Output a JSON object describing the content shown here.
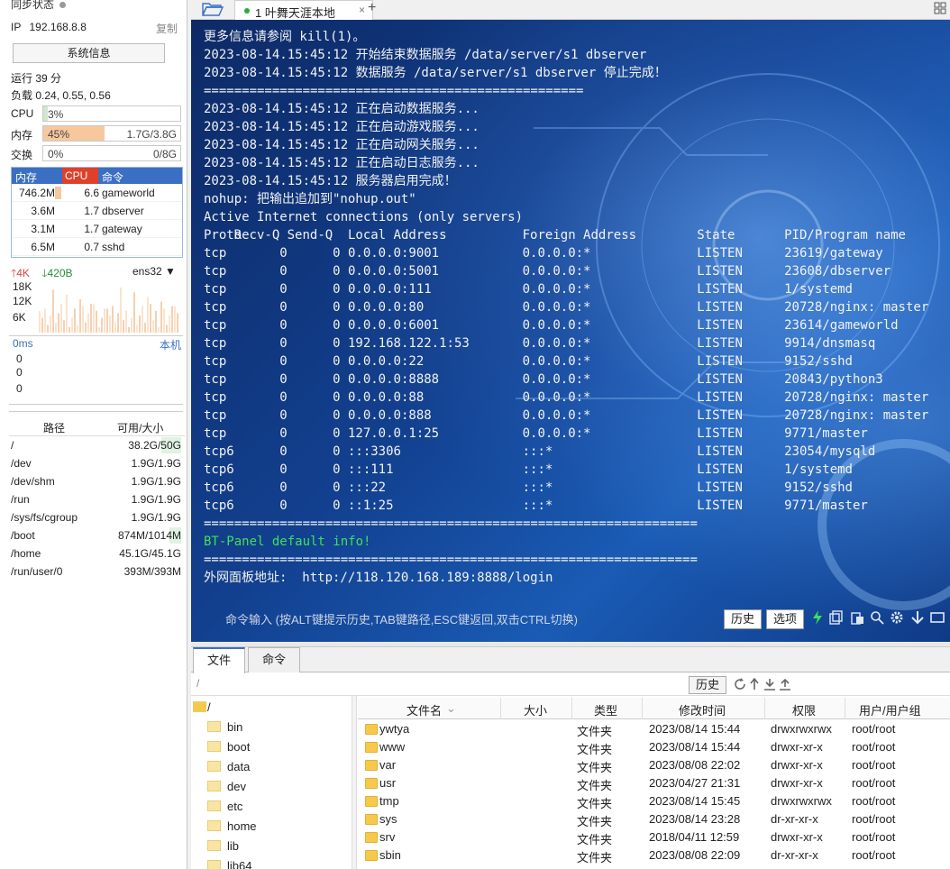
{
  "sidebar": {
    "sync_label": "同步状态",
    "ip_label": "IP",
    "ip": "192.168.8.8",
    "copy_label": "复制",
    "sysinfo_button": "系统信息",
    "uptime": "运行 39 分",
    "load": "负载 0.24, 0.55, 0.56",
    "cpu": {
      "label": "CPU",
      "pct": "3%",
      "fraction": 0.03
    },
    "mem": {
      "label": "内存",
      "pct": "45%",
      "amount": "1.7G/3.8G",
      "fraction": 0.45
    },
    "swap": {
      "label": "交换",
      "pct": "0%",
      "amount": "0/8G",
      "fraction": 0
    },
    "proc_headers": [
      "内存",
      "CPU",
      "命令"
    ],
    "processes": [
      {
        "mem": "746.2M",
        "cpu": "6.6",
        "cmd": "gameworld"
      },
      {
        "mem": "3.6M",
        "cpu": "1.7",
        "cmd": "dbserver"
      },
      {
        "mem": "3.1M",
        "cpu": "1.7",
        "cmd": "gateway"
      },
      {
        "mem": "6.5M",
        "cpu": "0.7",
        "cmd": "sshd"
      }
    ],
    "net_up": "4K",
    "net_down": "420B",
    "net_iface": "ens32",
    "graph_labels": [
      "18K",
      "12K",
      "6K"
    ],
    "latency_ms": "0ms",
    "latency_local": "本机",
    "latency_values": [
      "0",
      "0",
      "0"
    ],
    "disk_headers": [
      "路径",
      "可用/大小"
    ],
    "disks": [
      {
        "path": "/",
        "size": "38.2G/50G",
        "used_fraction": 0.24
      },
      {
        "path": "/dev",
        "size": "1.9G/1.9G",
        "used_fraction": 0
      },
      {
        "path": "/dev/shm",
        "size": "1.9G/1.9G",
        "used_fraction": 0
      },
      {
        "path": "/run",
        "size": "1.9G/1.9G",
        "used_fraction": 0
      },
      {
        "path": "/sys/fs/cgroup",
        "size": "1.9G/1.9G",
        "used_fraction": 0
      },
      {
        "path": "/boot",
        "size": "874M/1014M",
        "used_fraction": 0.14
      },
      {
        "path": "/home",
        "size": "45.1G/45.1G",
        "used_fraction": 0
      },
      {
        "path": "/run/user/0",
        "size": "393M/393M",
        "used_fraction": 0
      }
    ]
  },
  "tabbar": {
    "tab_title": "1 叶舞天涯本地",
    "close": "×",
    "add": "+"
  },
  "terminal": {
    "lines_top": [
      "更多信息请参阅 kill(1)。",
      "2023-08-14.15:45:12 开始结束数据服务 /data/server/s1 dbserver",
      "2023-08-14.15:45:12 数据服务 /data/server/s1 dbserver 停止完成！",
      "==================================================",
      "2023-08-14.15:45:12 正在启动数据服务...",
      "2023-08-14.15:45:12 正在启动游戏服务...",
      "2023-08-14.15:45:12 正在启动网关服务...",
      "2023-08-14.15:45:12 正在启动日志服务...",
      "2023-08-14.15:45:12 服务器启用完成！",
      "nohup: 把输出追加到\"nohup.out\"",
      "Active Internet connections (only servers)"
    ],
    "net_header": [
      "Proto",
      "Recv-Q",
      "Send-Q",
      "Local Address",
      "Foreign Address",
      "State",
      "PID/Program name"
    ],
    "net_rows": [
      [
        "tcp",
        "0",
        "0",
        "0.0.0.0:9001",
        "0.0.0.0:*",
        "LISTEN",
        "23619/gateway"
      ],
      [
        "tcp",
        "0",
        "0",
        "0.0.0.0:5001",
        "0.0.0.0:*",
        "LISTEN",
        "23608/dbserver"
      ],
      [
        "tcp",
        "0",
        "0",
        "0.0.0.0:111",
        "0.0.0.0:*",
        "LISTEN",
        "1/systemd"
      ],
      [
        "tcp",
        "0",
        "0",
        "0.0.0.0:80",
        "0.0.0.0:*",
        "LISTEN",
        "20728/nginx: master"
      ],
      [
        "tcp",
        "0",
        "0",
        "0.0.0.0:6001",
        "0.0.0.0:*",
        "LISTEN",
        "23614/gameworld"
      ],
      [
        "tcp",
        "0",
        "0",
        "192.168.122.1:53",
        "0.0.0.0:*",
        "LISTEN",
        "9914/dnsmasq"
      ],
      [
        "tcp",
        "0",
        "0",
        "0.0.0.0:22",
        "0.0.0.0:*",
        "LISTEN",
        "9152/sshd"
      ],
      [
        "tcp",
        "0",
        "0",
        "0.0.0.0:8888",
        "0.0.0.0:*",
        "LISTEN",
        "20843/python3"
      ],
      [
        "tcp",
        "0",
        "0",
        "0.0.0.0:88",
        "0.0.0.0:*",
        "LISTEN",
        "20728/nginx: master"
      ],
      [
        "tcp",
        "0",
        "0",
        "0.0.0.0:888",
        "0.0.0.0:*",
        "LISTEN",
        "20728/nginx: master"
      ],
      [
        "tcp",
        "0",
        "0",
        "127.0.0.1:25",
        "0.0.0.0:*",
        "LISTEN",
        "9771/master"
      ],
      [
        "tcp6",
        "0",
        "0",
        ":::3306",
        ":::*",
        "LISTEN",
        "23054/mysqld"
      ],
      [
        "tcp6",
        "0",
        "0",
        ":::111",
        ":::*",
        "LISTEN",
        "1/systemd"
      ],
      [
        "tcp6",
        "0",
        "0",
        ":::22",
        ":::*",
        "LISTEN",
        "9152/sshd"
      ],
      [
        "tcp6",
        "0",
        "0",
        "::1:25",
        ":::*",
        "LISTEN",
        "9771/master"
      ]
    ],
    "lines_bottom": [
      "=================================================================",
      "BT-Panel default info!",
      "=================================================================",
      "外网面板地址:  http://118.120.168.189:8888/login"
    ],
    "command_hint": "命令输入 (按ALT键提示历史,TAB键路径,ESC键返回,双击CTRL切换)",
    "history_button": "历史",
    "options_button": "选项"
  },
  "files": {
    "tab_files": "文件",
    "tab_commands": "命令",
    "path": "/",
    "history_button": "历史",
    "tree_root": "/",
    "tree": [
      "bin",
      "boot",
      "data",
      "dev",
      "etc",
      "home",
      "lib",
      "lib64"
    ],
    "headers": [
      "文件名",
      "大小",
      "类型",
      "修改时间",
      "权限",
      "用户/用户组"
    ],
    "rows": [
      {
        "name": "ywtya",
        "type": "文件夹",
        "mtime": "2023/08/14 15:44",
        "perm": "drwxrwxrwx",
        "owner": "root/root"
      },
      {
        "name": "www",
        "type": "文件夹",
        "mtime": "2023/08/14 15:44",
        "perm": "drwxr-xr-x",
        "owner": "root/root"
      },
      {
        "name": "var",
        "type": "文件夹",
        "mtime": "2023/08/08 22:02",
        "perm": "drwxr-xr-x",
        "owner": "root/root"
      },
      {
        "name": "usr",
        "type": "文件夹",
        "mtime": "2023/04/27 21:31",
        "perm": "drwxr-xr-x",
        "owner": "root/root"
      },
      {
        "name": "tmp",
        "type": "文件夹",
        "mtime": "2023/08/14 15:45",
        "perm": "drwxrwxrwx",
        "owner": "root/root"
      },
      {
        "name": "sys",
        "type": "文件夹",
        "mtime": "2023/08/14 23:28",
        "perm": "dr-xr-xr-x",
        "owner": "root/root"
      },
      {
        "name": "srv",
        "type": "文件夹",
        "mtime": "2018/04/11 12:59",
        "perm": "drwxr-xr-x",
        "owner": "root/root"
      },
      {
        "name": "sbin",
        "type": "文件夹",
        "mtime": "2023/08/08 22:09",
        "perm": "dr-xr-xr-x",
        "owner": "root/root"
      }
    ]
  },
  "colors": {
    "accent": "#3a6fc4",
    "mem_fill": "#f7c89e",
    "cpu_header": "#e0402a",
    "term_green": "#3ee05a",
    "folder": "#f6c94c"
  }
}
